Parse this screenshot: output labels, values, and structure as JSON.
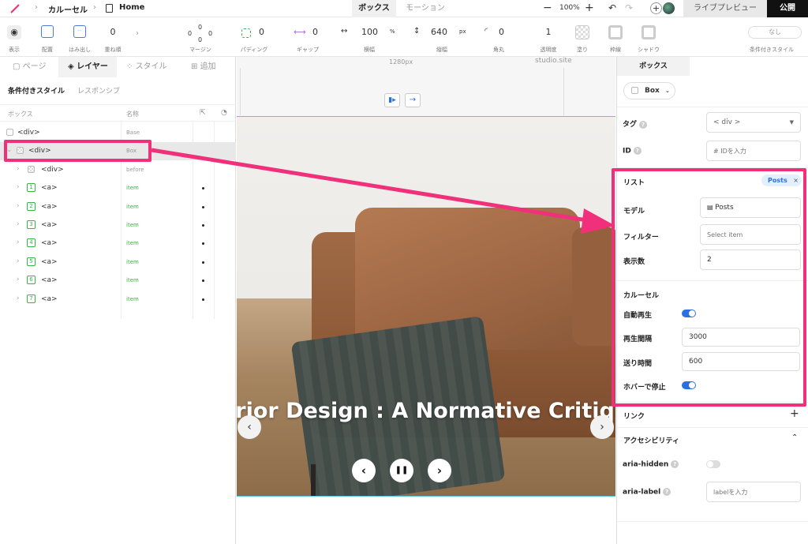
{
  "topbar": {
    "breadcrumb1": "カルーセル",
    "breadcrumb2": "Home",
    "tab_box": "ボックス",
    "tab_motion": "モーション",
    "zoom": "100%",
    "live_preview": "ライブプレビュー",
    "publish": "公開"
  },
  "toolbar": {
    "show": "表示",
    "layout": "配置",
    "overflow": "はみ出し",
    "zindex_val": "0",
    "zindex": "重ね順",
    "margin": "マージン",
    "margin_top": "0",
    "margin_left": "0",
    "margin_right": "0",
    "margin_bottom": "0",
    "padding": "パディング",
    "padding_val": "0",
    "gap": "ギャップ",
    "gap_val": "0",
    "width": "横幅",
    "width_val": "100",
    "width_unit": "%",
    "height": "縦幅",
    "height_val": "640",
    "height_unit": "px",
    "radius": "角丸",
    "radius_val": "0",
    "opacity": "透明度",
    "opacity_val": "1",
    "fill": "塗り",
    "border": "枠線",
    "shadow": "シャドウ",
    "cond_style": "条件付きスタイル",
    "cond_none": "なし"
  },
  "left": {
    "tabs": [
      "ページ",
      "レイヤー",
      "スタイル",
      "追加"
    ],
    "sub_tab1": "条件付きスタイル",
    "sub_tab2": "レスポンシブ",
    "col_box": "ボックス",
    "col_name": "名称",
    "rows": [
      {
        "tag": "<div>",
        "name": "Base"
      },
      {
        "tag": "<div>",
        "name": "Box"
      },
      {
        "tag": "<div>",
        "name": "before"
      },
      {
        "num": "1",
        "tag": "<a>",
        "name": "item"
      },
      {
        "num": "2",
        "tag": "<a>",
        "name": "item"
      },
      {
        "num": "3",
        "tag": "<a>",
        "name": "item"
      },
      {
        "num": "4",
        "tag": "<a>",
        "name": "item"
      },
      {
        "num": "5",
        "tag": "<a>",
        "name": "item"
      },
      {
        "num": "6",
        "tag": "<a>",
        "name": "item"
      },
      {
        "num": "7",
        "tag": "<a>",
        "name": "item"
      }
    ]
  },
  "canvas": {
    "ruler": "1280px",
    "site_label": "studio.site",
    "slide_title": "erior Design : A Normative Critique"
  },
  "right": {
    "tab": "ボックス",
    "element_type": "Box",
    "tag_label": "タグ",
    "tag_value": "< div >",
    "id_label": "ID",
    "id_placeholder": "# IDを入力",
    "list_label": "リスト",
    "list_badge": "Posts",
    "model_label": "モデル",
    "model_value": "Posts",
    "filter_label": "フィルター",
    "filter_placeholder": "Select item",
    "count_label": "表示数",
    "count_value": "2",
    "carousel_label": "カルーセル",
    "autoplay_label": "自動再生",
    "autoplay": true,
    "interval_label": "再生間隔",
    "interval_value": "3000",
    "speed_label": "送り時間",
    "speed_value": "600",
    "hover_label": "ホバーで停止",
    "hover": true,
    "link_label": "リンク",
    "a11y_label": "アクセシビリティ",
    "aria_hidden_label": "aria-hidden",
    "aria_hidden": false,
    "aria_label_label": "aria-label",
    "aria_label_placeholder": "labelを入力"
  },
  "colors": {
    "accent": "#f0307a",
    "blue": "#2b6fe0",
    "green": "#3bb34a",
    "topbar_dark": "#111111"
  }
}
